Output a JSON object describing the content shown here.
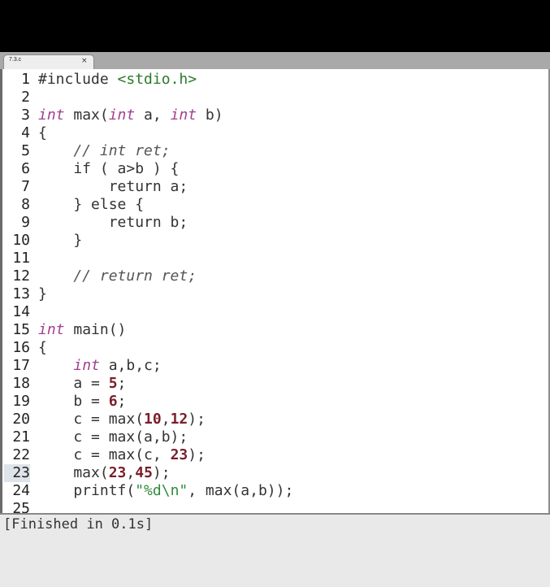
{
  "tab": {
    "title": "7.3.c",
    "close": "×"
  },
  "editor": {
    "current_line": 23,
    "lines": [
      {
        "n": "1",
        "segs": [
          {
            "t": "#include ",
            "c": "plain"
          },
          {
            "t": "<stdio.h>",
            "c": "inc"
          }
        ]
      },
      {
        "n": "2",
        "segs": []
      },
      {
        "n": "3",
        "segs": [
          {
            "t": "int",
            "c": "kw"
          },
          {
            "t": " max(",
            "c": "plain"
          },
          {
            "t": "int",
            "c": "kw"
          },
          {
            "t": " a, ",
            "c": "plain"
          },
          {
            "t": "int",
            "c": "kw"
          },
          {
            "t": " b)",
            "c": "plain"
          }
        ]
      },
      {
        "n": "4",
        "segs": [
          {
            "t": "{",
            "c": "plain"
          }
        ]
      },
      {
        "n": "5",
        "segs": [
          {
            "t": "    // int ret;",
            "c": "cmt"
          }
        ]
      },
      {
        "n": "6",
        "segs": [
          {
            "t": "    if ( a>b ) {",
            "c": "plain"
          }
        ]
      },
      {
        "n": "7",
        "segs": [
          {
            "t": "        return a;",
            "c": "plain"
          }
        ]
      },
      {
        "n": "8",
        "segs": [
          {
            "t": "    } else {",
            "c": "plain"
          }
        ]
      },
      {
        "n": "9",
        "segs": [
          {
            "t": "        return b;",
            "c": "plain"
          }
        ]
      },
      {
        "n": "10",
        "segs": [
          {
            "t": "    }",
            "c": "plain"
          }
        ]
      },
      {
        "n": "11",
        "segs": []
      },
      {
        "n": "12",
        "segs": [
          {
            "t": "    // return ret;",
            "c": "cmt"
          }
        ]
      },
      {
        "n": "13",
        "segs": [
          {
            "t": "}",
            "c": "plain"
          }
        ]
      },
      {
        "n": "14",
        "segs": []
      },
      {
        "n": "15",
        "segs": [
          {
            "t": "int",
            "c": "kw"
          },
          {
            "t": " main()",
            "c": "plain"
          }
        ]
      },
      {
        "n": "16",
        "segs": [
          {
            "t": "{",
            "c": "plain"
          }
        ]
      },
      {
        "n": "17",
        "segs": [
          {
            "t": "    ",
            "c": "plain"
          },
          {
            "t": "int",
            "c": "kw"
          },
          {
            "t": " a,b,c;",
            "c": "plain"
          }
        ]
      },
      {
        "n": "18",
        "segs": [
          {
            "t": "    a = ",
            "c": "plain"
          },
          {
            "t": "5",
            "c": "num"
          },
          {
            "t": ";",
            "c": "plain"
          }
        ]
      },
      {
        "n": "19",
        "segs": [
          {
            "t": "    b = ",
            "c": "plain"
          },
          {
            "t": "6",
            "c": "num"
          },
          {
            "t": ";",
            "c": "plain"
          }
        ]
      },
      {
        "n": "20",
        "segs": [
          {
            "t": "    c = max(",
            "c": "plain"
          },
          {
            "t": "10",
            "c": "num"
          },
          {
            "t": ",",
            "c": "plain"
          },
          {
            "t": "12",
            "c": "num"
          },
          {
            "t": ");",
            "c": "plain"
          }
        ]
      },
      {
        "n": "21",
        "segs": [
          {
            "t": "    c = max(a,b);",
            "c": "plain"
          }
        ]
      },
      {
        "n": "22",
        "segs": [
          {
            "t": "    c = max(c, ",
            "c": "plain"
          },
          {
            "t": "23",
            "c": "num"
          },
          {
            "t": ");",
            "c": "plain"
          }
        ]
      },
      {
        "n": "23",
        "segs": [
          {
            "t": "    max(",
            "c": "plain"
          },
          {
            "t": "23",
            "c": "num"
          },
          {
            "t": ",",
            "c": "plain"
          },
          {
            "t": "45",
            "c": "num"
          },
          {
            "t": ");",
            "c": "plain"
          }
        ]
      },
      {
        "n": "24",
        "segs": [
          {
            "t": "    printf(",
            "c": "plain"
          },
          {
            "t": "\"%d\\n\"",
            "c": "str"
          },
          {
            "t": ", max(a,b));",
            "c": "plain"
          }
        ]
      },
      {
        "n": "25",
        "segs": []
      }
    ]
  },
  "console": {
    "output": "[Finished in 0.1s]"
  },
  "colors": {
    "keyword": "#a23f8f",
    "number": "#7a1f2b",
    "string": "#2f8b3c",
    "comment": "#555555"
  }
}
